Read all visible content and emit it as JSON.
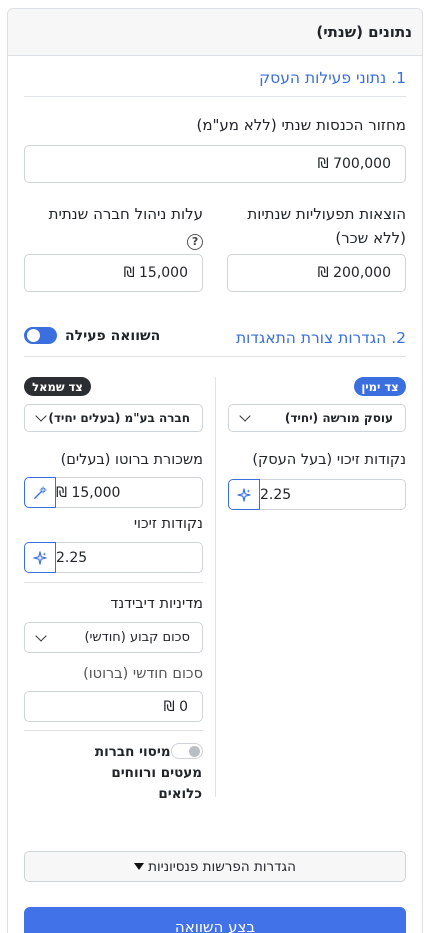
{
  "header": {
    "title": "נתונים (שנתי)"
  },
  "business": {
    "section_title": "1. נתוני פעילות העסק",
    "revenue": {
      "label": "מחזור הכנסות שנתי (ללא מע\"מ)",
      "value": "700,000 ₪"
    },
    "expenses": {
      "label_line1": "הוצאות תפעוליות שנתיות",
      "label_line2": "(ללא שכר)",
      "value": "200,000 ₪"
    },
    "mgmt_cost": {
      "label": "עלות ניהול חברה שנתית",
      "help": "?",
      "value": "15,000 ₪"
    }
  },
  "incorporation": {
    "section_title": "2. הגדרות צורת התאגדות",
    "compare_toggle_label": "השוואה פעילה",
    "right": {
      "badge": "צד ימין",
      "entity_select": "עוסק מורשה (יחיד)",
      "credit_points_label": "נקודות זיכוי (בעל העסק)",
      "credit_points_value": "2.25"
    },
    "left": {
      "badge": "צד שמאל",
      "entity_select": "חברה בע\"מ (בעלים יחיד)",
      "gross_salary_label": "משכורת ברוטו (בעלים)",
      "gross_salary_value": "15,000 ₪",
      "credit_points_label": "נקודות זיכוי",
      "credit_points_value": "2.25",
      "dividend_label": "מדיניות דיבידנד",
      "dividend_select": "סכום קבוע (חודשי)",
      "monthly_amount_label": "סכום חודשי (ברוטו)",
      "monthly_amount_value": "0 ₪",
      "special_tax_label_line1": "החל מיסוי חברות",
      "special_tax_label_line2": "מעטים ורווחים",
      "special_tax_label_line3": "כלואים"
    }
  },
  "pension_settings_label": "הגדרות הפרשות פנסיוניות",
  "run_button_label": "בצע השוואה",
  "icons": {
    "wand": "magic-wand-icon",
    "sparkle": "sparkle-icon",
    "chevron": "chevron-down-icon",
    "triangle": "caret-down-icon"
  },
  "colors": {
    "accent": "#3b6fe0",
    "section_title": "#3a6fd8",
    "dark_badge": "#2b2f33"
  }
}
